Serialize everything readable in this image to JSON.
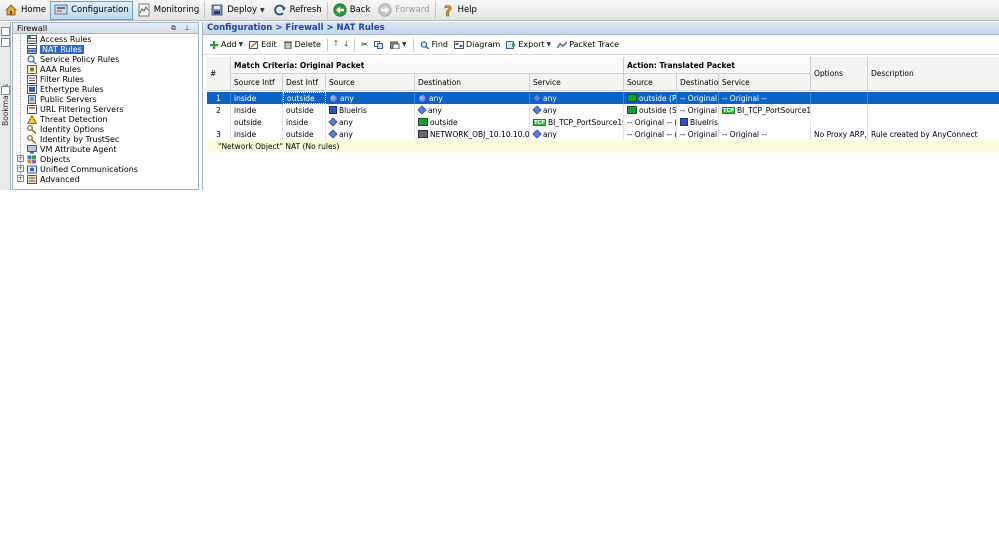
{
  "toolbar": {
    "home": "Home",
    "configuration": "Configuration",
    "monitoring": "Monitoring",
    "deploy": "Deploy",
    "refresh": "Refresh",
    "back": "Back",
    "forward": "Forward",
    "help": "Help"
  },
  "bookmarks": {
    "label": "Bookmarks"
  },
  "panel": {
    "title": "Firewall",
    "items": [
      {
        "label": "Access Rules"
      },
      {
        "label": "NAT Rules"
      },
      {
        "label": "Service Policy Rules"
      },
      {
        "label": "AAA Rules"
      },
      {
        "label": "Filter Rules"
      },
      {
        "label": "Ethertype Rules"
      },
      {
        "label": "Public Servers"
      },
      {
        "label": "URL Filtering Servers"
      },
      {
        "label": "Threat Detection"
      },
      {
        "label": "Identity Options"
      },
      {
        "label": "Identity by TrustSec"
      },
      {
        "label": "VM Attribute Agent"
      },
      {
        "label": "Objects"
      },
      {
        "label": "Unified Communications"
      },
      {
        "label": "Advanced"
      }
    ]
  },
  "breadcrumb": "Configuration > Firewall > NAT Rules",
  "nat_toolbar": {
    "add": "Add",
    "edit": "Edit",
    "delete": "Delete",
    "find": "Find",
    "diagram": "Diagram",
    "export": "Export",
    "packet_trace": "Packet Trace"
  },
  "table": {
    "group_headers": {
      "number": "#",
      "match": "Match Criteria: Original Packet",
      "action": "Action: Translated Packet",
      "options": "Options",
      "description": "Description"
    },
    "columns": {
      "src_intf": "Source Intf",
      "dst_intf": "Dest Intf",
      "source": "Source",
      "destination": "Destination",
      "service": "Service",
      "t_source": "Source",
      "t_destination": "Destination",
      "t_service": "Service"
    },
    "rows": [
      {
        "num": "1",
        "src_intf": "inside",
        "dst_intf": "outside",
        "source": "any",
        "destination": "any",
        "service": "any",
        "t_source": "outside (P)",
        "t_destination": "-- Original --",
        "t_service": "-- Original --",
        "options": "",
        "description": ""
      },
      {
        "num": "2",
        "src_intf": "inside",
        "dst_intf": "outside",
        "source": "BlueIris",
        "destination": "any",
        "service": "any",
        "t_source": "outside (S)",
        "t_destination": "-- Original --",
        "t_service": "BI_TCP_PortSource1060",
        "options": "",
        "description": ""
      },
      {
        "num": "",
        "src_intf": "outside",
        "dst_intf": "inside",
        "source": "any",
        "destination": "outside",
        "service": "BI_TCP_PortSource1060",
        "t_source": "-- Original -- (S)",
        "t_destination": "BlueIris",
        "t_service": "",
        "options": "",
        "description": ""
      },
      {
        "num": "3",
        "src_intf": "inside",
        "dst_intf": "outside",
        "source": "any",
        "destination": "NETWORK_OBJ_10.10.10.0_28",
        "service": "any",
        "t_source": "-- Original -- (S)",
        "t_destination": "-- Original --",
        "t_service": "-- Original --",
        "options": "No Proxy ARP,...",
        "description": "Rule created by AnyConnect"
      }
    ],
    "group_row": "\"Network Object\" NAT (No rules)"
  }
}
